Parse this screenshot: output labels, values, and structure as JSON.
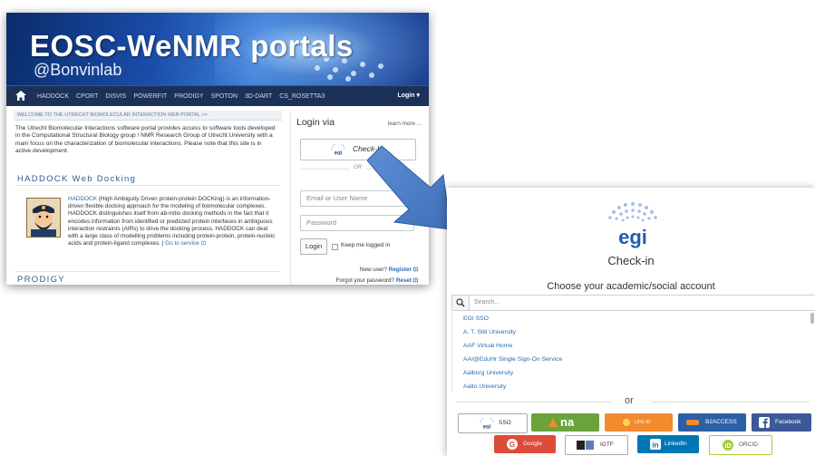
{
  "portal": {
    "banner_title": "EOSC-WeNMR portals",
    "banner_subtitle": "@Bonvinlab",
    "nav_items": [
      "HADDOCK",
      "CPORT",
      "DISVIS",
      "POWERFIT",
      "PRODIGY",
      "SPOTON",
      "3D-DART",
      "CS_ROSETTA3"
    ],
    "nav_login": "Login ▾",
    "welcome_bar": "WELCOME TO THE UTRECHT BIOMOLECULAR INTERACTION WEB PORTAL >>",
    "intro": "The Utrecht Biomolecular Interactions software portal provides access to software tools developed in the Computational Structural Biology group / NMR Research Group of Utrecht University with a main focus on the characterization of biomolecular interactions. Please note that this site is in active development.",
    "haddock_title": "HADDOCK Web Docking",
    "haddock_link": "HADDOCK",
    "haddock_desc": " (High Ambiguity Driven protein-protein DOCKing) is an information-driven flexible docking approach for the modeling of biomolecular complexes. HADDOCK distinguishes itself from ab-initio docking methods in the fact that it encodes information from identified or predicted protein interfaces in ambiguous interaction restraints (AIRs) to drive the docking process. HADDOCK can deal with a large class of modelling problems including protein-protein, protein-nucleic acids and protein-ligand complexes. | ",
    "go_to_service": "Go to service ⊡",
    "prodigy_title": "PRODIGY",
    "login": {
      "login_via": "Login via",
      "learn_more": "learn more ...",
      "checkin_label": "Check-In",
      "or": "OR",
      "email_placeholder": "Email or User Name",
      "password_placeholder": "Password",
      "login_button": "Login",
      "keep_logged_in": "Keep me logged in",
      "new_user_prefix": "New user? ",
      "register": "Register ⊡",
      "forgot_prefix": "Forgot your password? ",
      "reset": "Reset ⊡"
    }
  },
  "egi": {
    "logo_text": "egi",
    "title": "Check-in",
    "choose": "Choose your academic/social account",
    "search_placeholder": "Search...",
    "idps": [
      "EGI SSO",
      "A. T. Still University",
      "AAF Virtual Home",
      "AAI@EduHr Single Sign-On Service",
      "Aalborg University",
      "Aalto University"
    ],
    "or": "or",
    "social_row1": [
      {
        "label": "SSO",
        "icon": "egi-logo-icon"
      },
      {
        "label": "na",
        "icon": "elixir-icon"
      },
      {
        "label": "LIFE-ID",
        "icon": "life-id-icon"
      },
      {
        "label": "B2ACCESS",
        "icon": "eudat-icon"
      },
      {
        "label": "Facebook",
        "icon": "facebook-icon"
      }
    ],
    "social_row2": [
      {
        "label": "Google",
        "icon": "google-icon"
      },
      {
        "label": "IGTF",
        "icon": "igtf-icon"
      },
      {
        "label": "LinkedIn",
        "icon": "linkedin-icon"
      },
      {
        "label": "ORCID",
        "icon": "orcid-icon"
      }
    ],
    "colors": {
      "elixir": "#6aa33a",
      "life": "#f28a2e",
      "b2access": "#2b5fa6",
      "facebook": "#3b5998",
      "google": "#dd4b39",
      "linkedin": "#0077b5",
      "orcid": "#a6ce39",
      "accent": "#4a7ec4"
    }
  }
}
